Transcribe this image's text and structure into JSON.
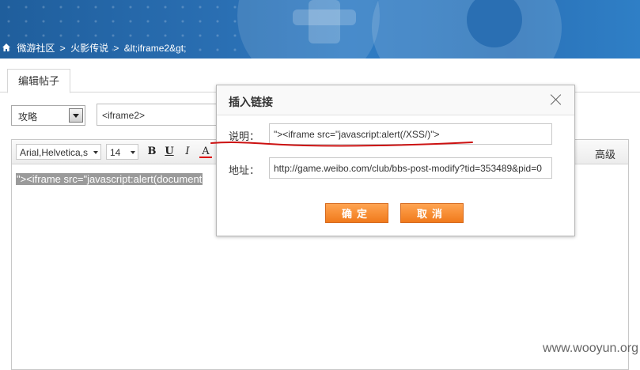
{
  "breadcrumb": {
    "items": [
      "微游社区",
      ">",
      "火影传说",
      ">",
      "&lt;iframe2&gt;"
    ]
  },
  "tab": {
    "label": "编辑帖子"
  },
  "form": {
    "category_value": "攻略",
    "title_value": "<iframe2>"
  },
  "editor": {
    "font_family": "Arial,Helvetica,s",
    "font_size": "14",
    "bold": "B",
    "underline": "U",
    "italic": "I",
    "color": "A",
    "advanced": "高级",
    "content": "\"><iframe src=\"javascript:alert(document"
  },
  "dialog": {
    "title": "插入链接",
    "desc_label": "说明：",
    "desc_value": "\"><iframe src=\"javascript:alert(/XSS/)\">",
    "url_label": "地址：",
    "url_value": "http://game.weibo.com/club/bbs-post-modify?tid=353489&pid=0",
    "confirm_label": "确定",
    "cancel_label": "取消"
  },
  "watermark": "www.wooyun.org",
  "colors": {
    "annotation": "#cc1111",
    "button": "#f07a1c"
  }
}
